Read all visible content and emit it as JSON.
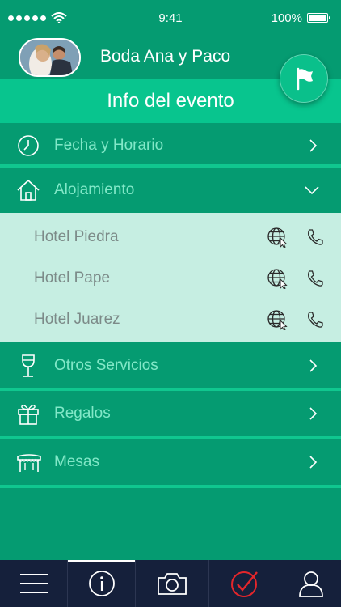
{
  "status": {
    "time": "9:41",
    "battery": "100%"
  },
  "header": {
    "event_title": "Boda Ana y Paco",
    "section_title": "Info del evento"
  },
  "menu": {
    "fecha": {
      "label": "Fecha y Horario",
      "icon": "clock-icon"
    },
    "alojamiento": {
      "label": "Alojamiento",
      "icon": "house-icon",
      "hotels": [
        {
          "name": "Hotel Piedra"
        },
        {
          "name": "Hotel Pape"
        },
        {
          "name": "Hotel Juarez"
        }
      ]
    },
    "otros": {
      "label": "Otros Servicios",
      "icon": "wine-glass-icon"
    },
    "regalos": {
      "label": "Regalos",
      "icon": "gift-icon"
    },
    "mesas": {
      "label": "Mesas",
      "icon": "table-icon"
    }
  },
  "tabs": [
    {
      "icon": "hamburger-menu-icon"
    },
    {
      "icon": "info-icon",
      "active": true
    },
    {
      "icon": "camera-icon"
    },
    {
      "icon": "check-circle-icon"
    },
    {
      "icon": "profile-icon"
    }
  ],
  "colors": {
    "background": "#059b71",
    "banner": "#08c58e",
    "sub_panel": "#c6eee2",
    "tabbar": "#15203b",
    "check_red": "#e4262b"
  }
}
